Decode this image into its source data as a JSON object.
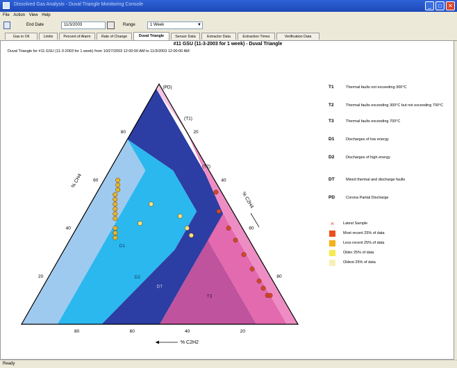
{
  "window": {
    "title": "Dissolved Gas Analysis - Duval Triangle Monitoring Console",
    "min_glyph": "_",
    "max_glyph": "□",
    "close_glyph": "✕"
  },
  "menu": {
    "items": [
      "File",
      "Action",
      "View",
      "Help"
    ]
  },
  "toolbar": {
    "end_date_label": "End Date",
    "end_date_value": "11/3/2003",
    "range_label": "Range",
    "range_value": "1 Week",
    "dropdown_glyph": "▼"
  },
  "tabs": [
    "Gas in Oil",
    "Limits",
    "Percent of Alarm",
    "Rate of Change",
    "Duval Triangle",
    "Sensor Data",
    "Extractor Data",
    "Extraction Times",
    "Verification Data"
  ],
  "active_tab": "Duval Triangle",
  "panel": {
    "title": "#11 GSU (11-3-2003 for 1 week) - Duval Triangle",
    "subtitle": "Duval Triangle for #11 GSU (11-3-2003 for 1 week) from 10/27/2003 12:00:00 AM to 11/3/2003 12:00:00 AM"
  },
  "legend": [
    {
      "code": "T1",
      "desc": "Thermal faults not exceeding 300°C"
    },
    {
      "code": "T2",
      "desc": "Thermal faults exceeding 300°C but not exceeding 700°C"
    },
    {
      "code": "T3",
      "desc": "Thermal faults exceeding 700°C"
    },
    {
      "code": "D1",
      "desc": "Discharges of low energy"
    },
    {
      "code": "D2",
      "desc": "Discharges of high energy"
    },
    {
      "code": "DT",
      "desc": "Mixed thermal and discharge faults"
    },
    {
      "code": "PD",
      "desc": "Corona Partial Discharge"
    }
  ],
  "samples_legend": [
    {
      "label": "Latest Sample",
      "color": "#e23a2a",
      "marker": "×"
    },
    {
      "label": "Most recent 25% of data",
      "color": "#e8501f",
      "marker": "square"
    },
    {
      "label": "Less recent 25% of data",
      "color": "#f2b21b",
      "marker": "square"
    },
    {
      "label": "Older 25% of data",
      "color": "#f6ea50",
      "marker": "square"
    },
    {
      "label": "Oldest 25% of data",
      "color": "#f7efb8",
      "marker": "square"
    }
  ],
  "status": {
    "text": "Ready"
  },
  "chart_data": {
    "type": "scatter",
    "title": "",
    "axes": [
      {
        "label": "% CH4",
        "ticks": [
          "20",
          "40",
          "60",
          "80"
        ]
      },
      {
        "label": "% C2H4",
        "ticks": [
          "20",
          "40",
          "60",
          "80"
        ]
      },
      {
        "label": "% C2H2",
        "ticks": [
          "80",
          "60",
          "40",
          "20"
        ]
      }
    ],
    "regions": [
      {
        "name": "PD",
        "label": "(PD)",
        "color": "#f5c5e3"
      },
      {
        "name": "T1",
        "label": "(T1)",
        "color": "#ee8dc4"
      },
      {
        "name": "T2",
        "label": "(T2)",
        "color": "#e36aae"
      },
      {
        "name": "T3",
        "label": "T3",
        "color": "#c0539d"
      },
      {
        "name": "DT",
        "label": "DT",
        "color": "#2c3da3"
      },
      {
        "name": "D1",
        "label": "D1",
        "color": "#9fcaef"
      },
      {
        "name": "D2",
        "label": "D2",
        "color": "#2ab8ee"
      }
    ],
    "series": [
      {
        "name": "Most recent 25% of data",
        "color": "#d04828",
        "points": [
          [
            55,
            43,
            2
          ],
          [
            47,
            48,
            5
          ],
          [
            40,
            55,
            5
          ],
          [
            35,
            60,
            5
          ],
          [
            29,
            66,
            5
          ],
          [
            23,
            72,
            5
          ],
          [
            18,
            77,
            5
          ],
          [
            15,
            80,
            5
          ],
          [
            12,
            83,
            5
          ],
          [
            12,
            84,
            4
          ]
        ]
      },
      {
        "name": "Oldest 25% of data",
        "color": "#f5e47a",
        "points": [
          [
            45,
            35,
            20
          ],
          [
            40,
            40,
            20
          ],
          [
            37,
            43,
            20
          ],
          [
            50,
            22,
            28
          ],
          [
            42,
            22,
            36
          ]
        ]
      },
      {
        "name": "Less recent 25% of data",
        "color": "#e3b72a",
        "points": [
          [
            60,
            5,
            35
          ],
          [
            58,
            6,
            36
          ],
          [
            56,
            7,
            37
          ],
          [
            54,
            7,
            39
          ],
          [
            52,
            8,
            40
          ],
          [
            50,
            9,
            41
          ],
          [
            48,
            10,
            42
          ],
          [
            46,
            11,
            43
          ],
          [
            44,
            12,
            44
          ],
          [
            40,
            14,
            46
          ],
          [
            38,
            15,
            47
          ],
          [
            36,
            16,
            48
          ]
        ]
      }
    ]
  }
}
